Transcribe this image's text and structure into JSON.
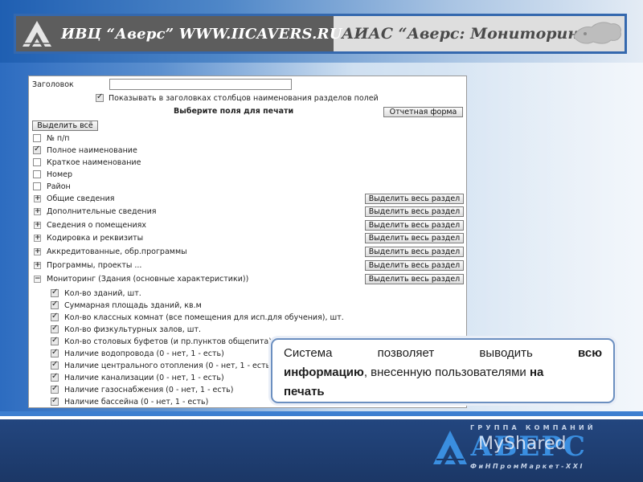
{
  "banner": {
    "org": "ИВЦ “Аверс”  WWW.IICAVERS.RU",
    "title": "АИАС “Аверс: Мониторинг”"
  },
  "form": {
    "header_label": "Заголовок",
    "header_value": "",
    "show_sections_label": "Показывать в заголовках столбцов наименования разделов полей",
    "show_sections_checked": true,
    "select_fields_title": "Выберите поля для печати",
    "report_form_button": "Отчетная форма",
    "select_all_button": "Выделить всё",
    "fields": [
      {
        "label": "№ п/п",
        "checked": false
      },
      {
        "label": "Полное наименование",
        "checked": true
      },
      {
        "label": "Краткое наименование",
        "checked": false
      },
      {
        "label": "Номер",
        "checked": false
      },
      {
        "label": "Район",
        "checked": false
      }
    ],
    "select_section_button": "Выделить весь раздел",
    "sections": [
      {
        "label": "Общие сведения",
        "expanded": false
      },
      {
        "label": "Дополнительные сведения",
        "expanded": false
      },
      {
        "label": "Сведения о помещениях",
        "expanded": false
      },
      {
        "label": "Кодировка и реквизиты",
        "expanded": false
      },
      {
        "label": "Аккредитованные, обр.программы",
        "expanded": false
      },
      {
        "label": "Программы, проекты ...",
        "expanded": false
      },
      {
        "label": "Мониторинг (Здания (основные характеристики))",
        "expanded": true
      }
    ],
    "monitoring_fields": [
      {
        "label": "Кол-во зданий, шт.",
        "checked": true
      },
      {
        "label": "Суммарная площадь зданий, кв.м",
        "checked": true
      },
      {
        "label": "Кол-во классных комнат (все помещения для исп.для обучения), шт.",
        "checked": true
      },
      {
        "label": "Кол-во физкультурных залов, шт.",
        "checked": true
      },
      {
        "label": "Кол-во столовых буфетов (и пр.пунктов общепита), шт.",
        "checked": true
      },
      {
        "label": "Наличие водопровода (0 - нет, 1 - есть)",
        "checked": true
      },
      {
        "label": "Наличие центрального отопления (0 - нет, 1 - есть)",
        "checked": true
      },
      {
        "label": "Наличие канализации (0 - нет, 1 - есть)",
        "checked": true
      },
      {
        "label": "Наличие газоснабжения (0 - нет, 1 - есть)",
        "checked": true
      },
      {
        "label": "Наличие бассейна (0 - нет, 1 - есть)",
        "checked": true
      }
    ]
  },
  "callout": {
    "w1": "Система",
    "w2": "позволяет",
    "w3": "выводить",
    "w4": "всю",
    "l2_bold": "информацию",
    "l2_rest": ", внесенную пользователями ",
    "l2_bold2": "на",
    "l3_bold": "печать"
  },
  "footer_logo": {
    "top": "ГРУППА КОМПАНИЙ",
    "name": "АВЕРС",
    "bottom": "ФиНПромМаркет-XXI",
    "watermark": "MyShared"
  },
  "colors": {
    "banner_border": "#3468ae",
    "accent_blue": "#3a8ee0",
    "footer_bg": "#1b3766"
  }
}
